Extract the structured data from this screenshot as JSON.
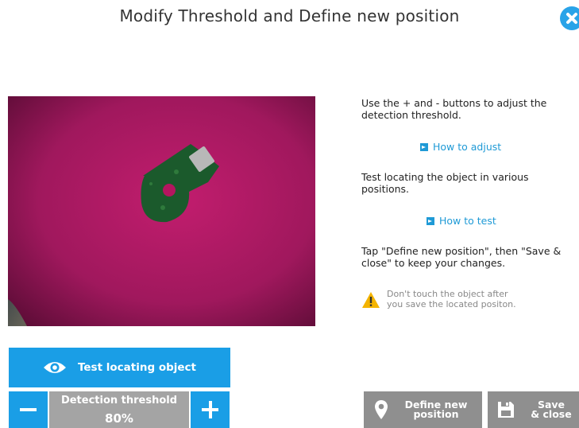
{
  "header": {
    "title": "Modify Threshold and Define new position"
  },
  "instructions": {
    "adjust_text": "Use the + and - buttons to adjust the detection threshold.",
    "adjust_link": "How to adjust",
    "test_text": "Test locating the object in various positions.",
    "test_link": "How to test",
    "define_text": "Tap \"Define new position\", then \"Save & close\" to keep your changes.",
    "warning_line1": "Don't touch the object after",
    "warning_line2": "you save the located positon."
  },
  "controls": {
    "test_label": "Test locating object",
    "threshold_label": "Detection threshold",
    "threshold_value": "80%",
    "define_line1": "Define new",
    "define_line2": "position",
    "save_line1": "Save",
    "save_line2": "& close"
  },
  "colors": {
    "accent": "#1a9ee6",
    "button_gray": "#8f8f8f",
    "camera_background": "#9a1657",
    "warning": "#f4b400"
  },
  "icons": {
    "close": "close-icon",
    "eye": "eye-icon",
    "minus": "minus-icon",
    "plus": "plus-icon",
    "pin": "location-pin-icon",
    "save": "floppy-disk-icon",
    "warning": "warning-icon",
    "link": "link-arrow-icon"
  }
}
